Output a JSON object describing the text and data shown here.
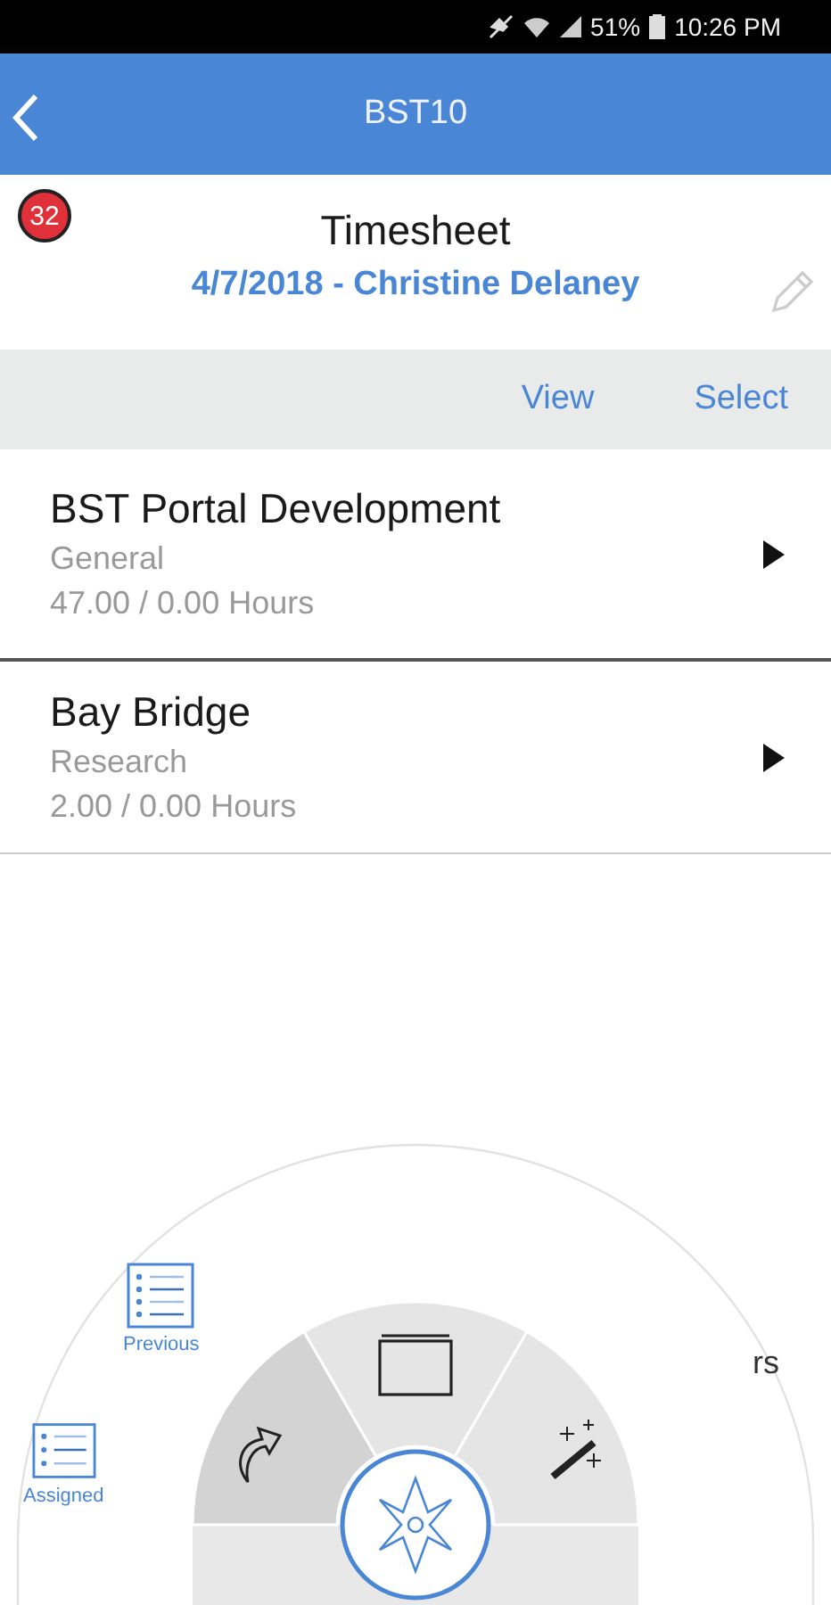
{
  "status_bar": {
    "battery": "51%",
    "time": "10:26 PM"
  },
  "header": {
    "title": "BST10"
  },
  "badge": {
    "count": "32"
  },
  "timesheet": {
    "title": "Timesheet",
    "subtitle": "4/7/2018 - Christine Delaney"
  },
  "toolbar": {
    "actions": [
      "View",
      "Select"
    ]
  },
  "projects": [
    {
      "name": "BST Portal Development",
      "category": "General",
      "hours": "47.00 / 0.00 Hours"
    },
    {
      "name": "Bay Bridge",
      "category": "Research",
      "hours": "2.00 / 0.00 Hours"
    }
  ],
  "radial_menu": {
    "segments": [
      {
        "kind": "arrow",
        "selected": true
      },
      {
        "kind": "window",
        "selected": false
      },
      {
        "kind": "wand",
        "selected": false
      }
    ],
    "items": [
      {
        "kind": "list",
        "label": "Previous"
      },
      {
        "kind": "list",
        "label": "Assigned"
      },
      {
        "kind": "text",
        "label": "rs"
      }
    ]
  }
}
